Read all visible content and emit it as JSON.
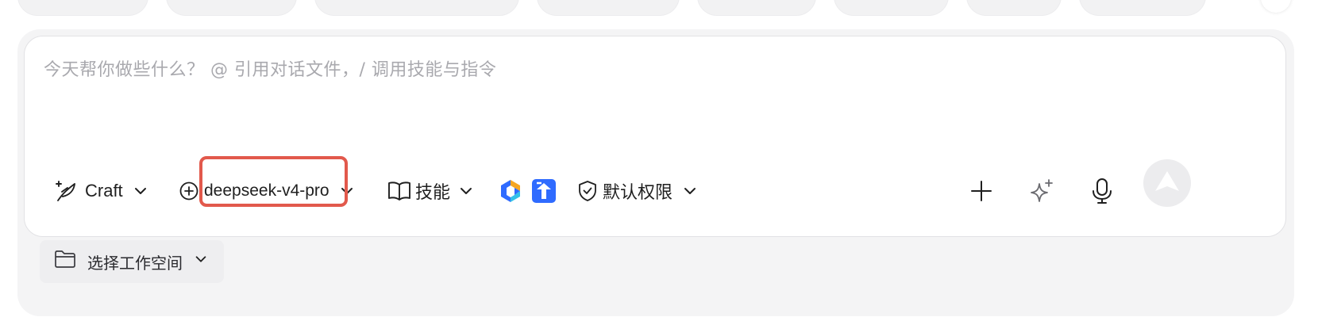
{
  "prompt": {
    "placeholder": "今天帮你做些什么？ @ 引用对话文件，/ 调用技能与指令"
  },
  "toolbar": {
    "mode_label": "Craft",
    "mode_icon": "quill-sparkle-icon",
    "model_label": "deepseek-v4-pro",
    "model_icon": "circle-plus-icon",
    "skills_label": "技能",
    "skills_icon": "open-book-icon",
    "permission_label": "默认权限",
    "permission_icon": "shield-check-icon",
    "add_icon": "plus-icon",
    "enhance_icon": "sparkle-icon",
    "voice_icon": "microphone-icon",
    "send_icon": "send-arrow-icon"
  },
  "workspace": {
    "label": "选择工作空间",
    "icon": "folder-icon"
  },
  "colors": {
    "highlight": "#e2594c",
    "panel": "#f4f4f5",
    "placeholder": "#a9a9ae",
    "send_disabled": "#ececee",
    "app_blue": "#2f6bff"
  }
}
